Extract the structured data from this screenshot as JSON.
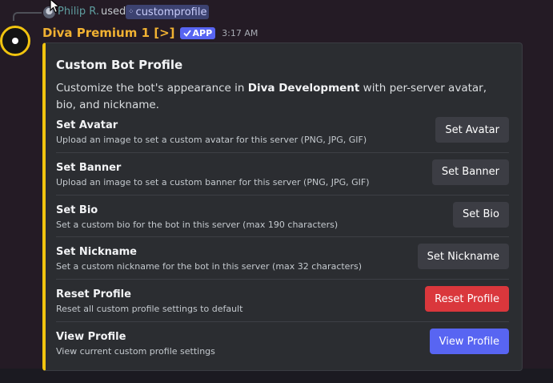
{
  "reply": {
    "username": "Philip R.",
    "used_text": "used",
    "command": "customprofile"
  },
  "message": {
    "author": "Diva Premium 1 [>]",
    "badge": "APP",
    "time": "3:17 AM"
  },
  "embed": {
    "title": "Custom Bot Profile",
    "desc_before": "Customize the bot's appearance in ",
    "desc_bold": "Diva Development",
    "desc_after": " with per-server avatar, bio, and nickname.",
    "accent_color": "#f1c40f",
    "rows": [
      {
        "title": "Set Avatar",
        "desc": "Upload an image to set a custom avatar for this server (PNG, JPG, GIF)",
        "button": "Set Avatar",
        "style": "secondary"
      },
      {
        "title": "Set Banner",
        "desc": "Upload an image to set a custom banner for this server (PNG, JPG, GIF)",
        "button": "Set Banner",
        "style": "secondary"
      },
      {
        "title": "Set Bio",
        "desc": "Set a custom bio for the bot in this server (max 190 characters)",
        "button": "Set Bio",
        "style": "secondary"
      },
      {
        "title": "Set Nickname",
        "desc": "Set a custom nickname for the bot in this server (max 32 characters)",
        "button": "Set Nickname",
        "style": "secondary"
      },
      {
        "title": "Reset Profile",
        "desc": "Reset all custom profile settings to default",
        "button": "Reset Profile",
        "style": "danger"
      },
      {
        "title": "View Profile",
        "desc": "View current custom profile settings",
        "button": "View Profile",
        "style": "primary"
      }
    ]
  },
  "colors": {
    "background": "#241b25",
    "embed_bg": "#2b2d31",
    "author": "#f0b132",
    "app_badge": "#5865f2",
    "danger": "#da373c",
    "primary": "#5865f2",
    "secondary": "#3c3d44"
  }
}
